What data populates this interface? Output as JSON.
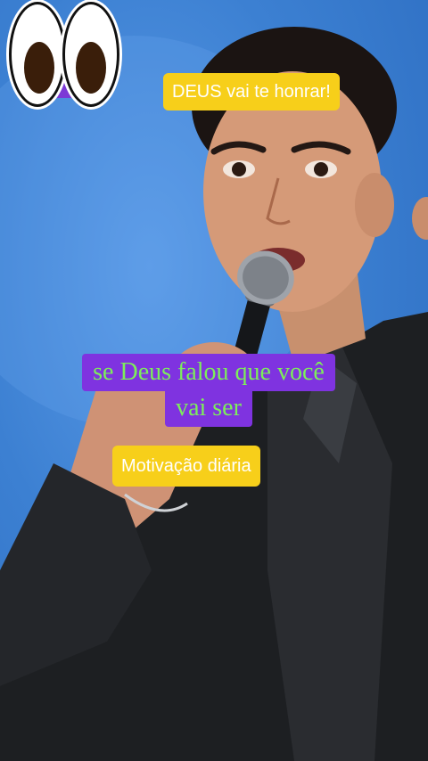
{
  "video": {
    "sticker_icon": "googly-eyes-icon",
    "captions": {
      "top": "DEUS vai te honrar!",
      "middle_line1": "se Deus falou que você",
      "middle_line2": "vai ser",
      "bottom": "Motivação diária"
    },
    "colors": {
      "background_blue": "#3c80d2",
      "caption_yellow": "#f7cf1a",
      "caption_purple": "#7f33e0",
      "caption_green_text": "#7dee5a"
    }
  }
}
